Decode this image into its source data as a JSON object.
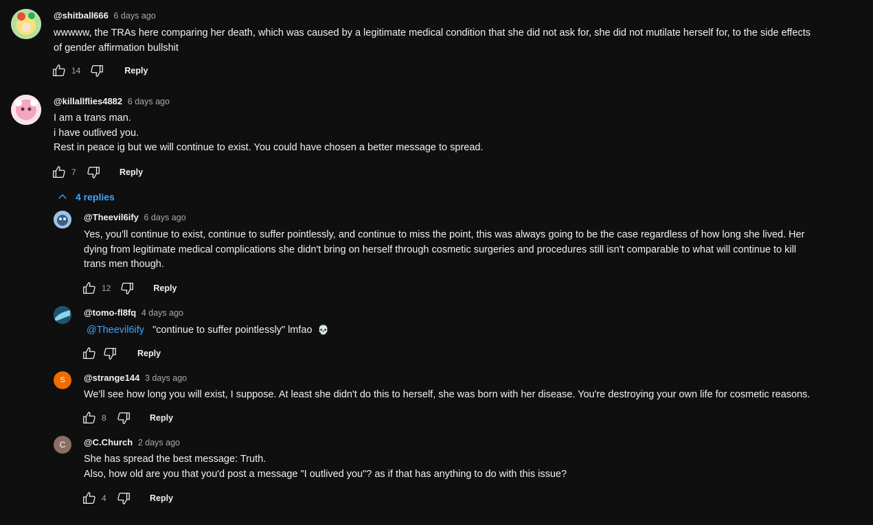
{
  "comments": [
    {
      "author": "@shitball666",
      "time": "6 days ago",
      "lines": [
        "wwwww, the TRAs here comparing her death, which was caused by a legitimate medical condition that she did not ask for, she did not mutilate herself for, to the side effects",
        "of gender affirmation bullshit"
      ],
      "likes": "14",
      "reply_label": "Reply",
      "avatar": {
        "colors": [
          "#f4d03f",
          "#e67e22",
          "#2ecc71"
        ]
      }
    },
    {
      "author": "@killallflies4882",
      "time": "6 days ago",
      "lines": [
        "I am a trans man.",
        "i have outlived you.",
        "Rest in peace ig but we will continue to exist. You could have chosen a better message to spread."
      ],
      "likes": "7",
      "reply_label": "Reply",
      "avatar": {
        "colors": [
          "#f8c8d8",
          "#e88aa8",
          "#ffffff"
        ]
      }
    }
  ],
  "replies_toggle": {
    "label": "4 replies",
    "color": "#3ea6ff"
  },
  "replies": [
    {
      "author": "@Theevil6ify",
      "time": "6 days ago",
      "lines": [
        "Yes, you'll continue to exist, continue to suffer pointlessly, and continue to miss the point, this was always going to be the case regardless of how long she lived. Her",
        "dying from legitimate medical complications she didn't bring on herself through cosmetic surgeries and procedures still isn't comparable to what will continue to kill",
        "trans men though."
      ],
      "likes": "12",
      "reply_label": "Reply",
      "avatar": {
        "colors": [
          "#5d7fa3",
          "#b9d3ef"
        ]
      }
    },
    {
      "author": "@tomo-fl8fq",
      "time": "4 days ago",
      "mention": "@Theevil6ify",
      "text": "\"continue to suffer pointlessly\" lmfao",
      "emoji": "💀",
      "likes": "",
      "reply_label": "Reply",
      "avatar": {
        "colors": [
          "#2c6b8a",
          "#8fd3e8"
        ]
      }
    },
    {
      "author": "@strange144",
      "time": "3 days ago",
      "lines": [
        "We'll see how long you will exist, I suppose. At least she didn't do this to herself, she was born with her disease. You're destroying your own life for cosmetic reasons."
      ],
      "likes": "8",
      "reply_label": "Reply",
      "avatar": {
        "letter": "S",
        "bg": "#ef6c00"
      }
    },
    {
      "author": "@C.Church",
      "time": "2 days ago",
      "lines": [
        "She has spread the best message: Truth.",
        "Also, how old are you that you'd post a message \"I outlived you\"? as if that has anything to do with this issue?"
      ],
      "likes": "4",
      "reply_label": "Reply",
      "avatar": {
        "letter": "C",
        "bg": "#8d6e63"
      }
    }
  ]
}
